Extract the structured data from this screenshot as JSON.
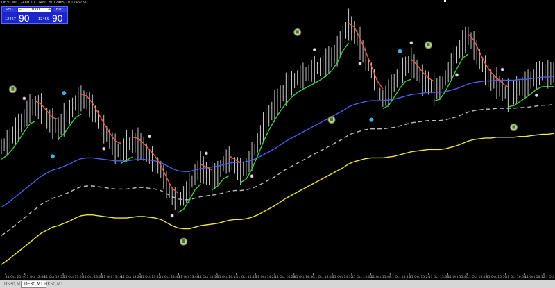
{
  "window": {
    "symbol_line": "DE30,M1  12480.20 12480.20 12465.70 12467.90"
  },
  "trade_panel": {
    "sell_label": "SELL",
    "buy_label": "BUY",
    "lot_value": "10.00",
    "minus": "−",
    "plus": "+",
    "bid_prefix": "12467",
    "bid_big": "90",
    "ask_prefix": "12469",
    "ask_big": "90"
  },
  "tabs": [
    {
      "label": "US30,M1",
      "active": false
    },
    {
      "label": "DE30,M1",
      "active": true
    },
    {
      "label": "HK50,M1",
      "active": false
    }
  ],
  "colors": {
    "background": "#000000",
    "bars": "#c8c8c8",
    "ema_blue": "#4a5ee8",
    "band_yellow": "#f2e23c",
    "band_dashed": "#bdbdbd",
    "hma_red": "#e85a4a",
    "hma_green": "#3fcf3f",
    "signal_cyan": "#3cb0e6"
  },
  "chart_data": {
    "type": "line",
    "symbol": "DE30",
    "timeframe": "M1",
    "x_tick_labels": [
      "11 Oct 2019",
      "11 Oct 12:44",
      "11 Oct 12:52",
      "11 Oct 13:00",
      "11 Oct 13:08",
      "11 Oct 13:16",
      "11 Oct 13:24",
      "11 Oct 13:32",
      "11 Oct 13:40",
      "11 Oct 13:48",
      "11 Oct 13:56",
      "11 Oct 14:04",
      "11 Oct 14:12",
      "11 Oct 14:20",
      "11 Oct 14:28",
      "11 Oct 14:36",
      "11 Oct 14:44",
      "11 Oct 14:52",
      "11 Oct 15:00",
      "11 Oct 15:08",
      "11 Oct 15:16",
      "11 Oct 15:24",
      "11 Oct 15:32",
      "11 Oct 15:40",
      "11 Oct 15:48",
      "11 Oct 15:56",
      "11 Oct 16:04",
      "11 Oct 16:12",
      "11 Oct 16:20"
    ],
    "price_series": [
      12395,
      12400,
      12410,
      12420,
      12432,
      12445,
      12448,
      12445,
      12432,
      12425,
      12418,
      12430,
      12440,
      12452,
      12458,
      12455,
      12445,
      12430,
      12418,
      12405,
      12392,
      12388,
      12395,
      12402,
      12398,
      12392,
      12382,
      12375,
      12365,
      12345,
      12330,
      12322,
      12330,
      12340,
      12358,
      12368,
      12360,
      12352,
      12360,
      12372,
      12378,
      12370,
      12362,
      12368,
      12382,
      12400,
      12420,
      12435,
      12448,
      12460,
      12470,
      12478,
      12485,
      12488,
      12492,
      12496,
      12500,
      12505,
      12512,
      12520,
      12540,
      12555,
      12545,
      12530,
      12510,
      12495,
      12470,
      12458,
      12465,
      12478,
      12490,
      12500,
      12505,
      12495,
      12482,
      12478,
      12470,
      12472,
      12485,
      12500,
      12515,
      12530,
      12540,
      12528,
      12510,
      12495,
      12482,
      12478,
      12470,
      12462,
      12466,
      12472,
      12476,
      12482,
      12488,
      12494,
      12490,
      12492
    ],
    "series": [
      {
        "name": "",
        "color": "#4a5ee8",
        "values": [
          12315,
          12320,
          12326,
          12332,
          12338,
          12344,
          12350,
          12356,
          12360,
          12364,
          12366,
          12369,
          12372,
          12376,
          12379,
          12380,
          12380,
          12379,
          12378,
          12377,
          12376,
          12376,
          12376,
          12377,
          12378,
          12378,
          12377,
          12376,
          12374,
          12370,
          12366,
          12363,
          12362,
          12362,
          12364,
          12366,
          12367,
          12368,
          12369,
          12371,
          12373,
          12374,
          12374,
          12375,
          12377,
          12380,
          12384,
          12388,
          12392,
          12397,
          12402,
          12406,
          12410,
          12414,
          12418,
          12422,
          12426,
          12430,
          12434,
          12438,
          12442,
          12447,
          12450,
          12452,
          12454,
          12455,
          12455,
          12455,
          12456,
          12457,
          12459,
          12461,
          12463,
          12464,
          12465,
          12466,
          12466,
          12466,
          12467,
          12469,
          12471,
          12474,
          12477,
          12479,
          12480,
          12481,
          12481,
          12482,
          12482,
          12482,
          12482,
          12483,
          12483,
          12484,
          12485,
          12486,
          12486,
          12487
        ]
      },
      {
        "name": "",
        "color": "#bdbdbd",
        "values": [
          12278,
          12283,
          12289,
          12295,
          12301,
          12307,
          12313,
          12319,
          12323,
          12327,
          12329,
          12332,
          12335,
          12339,
          12342,
          12343,
          12343,
          12342,
          12341,
          12340,
          12339,
          12339,
          12339,
          12340,
          12341,
          12341,
          12340,
          12339,
          12337,
          12333,
          12329,
          12326,
          12325,
          12325,
          12327,
          12329,
          12330,
          12331,
          12332,
          12334,
          12336,
          12337,
          12337,
          12338,
          12340,
          12343,
          12347,
          12351,
          12355,
          12360,
          12365,
          12369,
          12373,
          12377,
          12381,
          12385,
          12389,
          12393,
          12397,
          12401,
          12405,
          12410,
          12413,
          12415,
          12417,
          12418,
          12418,
          12418,
          12419,
          12420,
          12422,
          12424,
          12426,
          12427,
          12428,
          12429,
          12429,
          12429,
          12430,
          12432,
          12434,
          12437,
          12440,
          12442,
          12443,
          12444,
          12444,
          12445,
          12445,
          12445,
          12445,
          12446,
          12446,
          12447,
          12448,
          12449,
          12449,
          12450
        ]
      },
      {
        "name": "",
        "color": "#f2e23c",
        "values": [
          12240,
          12245,
          12251,
          12257,
          12263,
          12269,
          12275,
          12281,
          12285,
          12289,
          12291,
          12294,
          12297,
          12301,
          12304,
          12305,
          12305,
          12304,
          12303,
          12302,
          12301,
          12301,
          12301,
          12302,
          12303,
          12303,
          12302,
          12301,
          12299,
          12295,
          12291,
          12288,
          12287,
          12287,
          12289,
          12291,
          12292,
          12293,
          12294,
          12296,
          12298,
          12299,
          12299,
          12300,
          12302,
          12305,
          12309,
          12313,
          12317,
          12322,
          12327,
          12331,
          12335,
          12339,
          12343,
          12347,
          12351,
          12355,
          12359,
          12363,
          12367,
          12372,
          12375,
          12377,
          12379,
          12380,
          12380,
          12380,
          12381,
          12382,
          12384,
          12386,
          12388,
          12389,
          12390,
          12391,
          12391,
          12391,
          12392,
          12394,
          12396,
          12399,
          12402,
          12404,
          12405,
          12406,
          12406,
          12407,
          12407,
          12407,
          12407,
          12408,
          12408,
          12409,
          12410,
          12411,
          12411,
          12412
        ]
      }
    ],
    "up_arrow_markers": [
      {
        "index": 2,
        "price": 12470
      },
      {
        "index": 32,
        "price": 12270
      },
      {
        "index": 52,
        "price": 12545
      },
      {
        "index": 58,
        "price": 12430
      },
      {
        "index": 75,
        "price": 12528
      },
      {
        "index": 90,
        "price": 12420
      }
    ],
    "cyan_dot_markers": [
      {
        "index": 11,
        "price": 12465
      },
      {
        "index": 65,
        "price": 12430
      },
      {
        "index": 9,
        "price": 12382
      },
      {
        "index": 70,
        "price": 12520
      }
    ],
    "ylim": [
      12230,
      12580
    ]
  }
}
